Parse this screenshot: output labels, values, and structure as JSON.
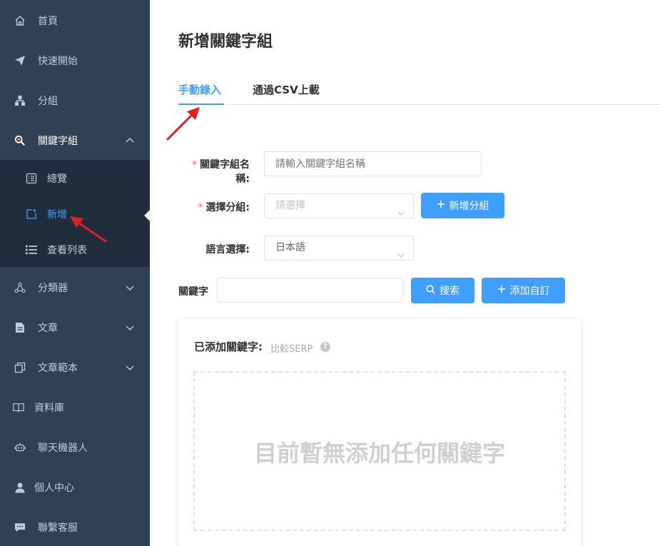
{
  "sidebar": {
    "items": [
      {
        "label": "首頁",
        "icon": "home-icon"
      },
      {
        "label": "快速開始",
        "icon": "paper-plane-icon"
      },
      {
        "label": "分組",
        "icon": "sitemap-icon"
      },
      {
        "label": "關鍵字組",
        "icon": "search-key-icon",
        "expanded": true
      },
      {
        "label": "分類器",
        "icon": "classifier-icon"
      },
      {
        "label": "文章",
        "icon": "document-icon"
      },
      {
        "label": "文章範本",
        "icon": "copy-icon"
      },
      {
        "label": "資料庫",
        "icon": "book-icon"
      },
      {
        "label": "聊天機器人",
        "icon": "robot-icon"
      },
      {
        "label": "個人中心",
        "icon": "user-icon"
      },
      {
        "label": "聯繫客服",
        "icon": "chat-icon"
      }
    ],
    "submenu": [
      {
        "label": "總覽",
        "icon": "list-alt-icon"
      },
      {
        "label": "新增",
        "icon": "new-doc-icon",
        "active": true
      },
      {
        "label": "查看列表",
        "icon": "list-icon"
      }
    ]
  },
  "main": {
    "title": "新增關鍵字組",
    "tabs": [
      {
        "label": "手動錄入",
        "active": true
      },
      {
        "label": "通過CSV上載",
        "active": false
      }
    ],
    "form": {
      "name_label": "關鍵字組名稱:",
      "name_placeholder": "請輸入關鍵字組名稱",
      "group_label": "選擇分組:",
      "group_placeholder": "請選擇",
      "add_group_button": "新增分組",
      "lang_label": "語言選擇:",
      "lang_value": "日本語",
      "keyword_label": "關鍵字",
      "keyword_value": "",
      "search_button": "搜索",
      "custom_button": "添加自訂"
    },
    "card": {
      "title": "已添加關鍵字:",
      "compare": "比較SERP",
      "help": "?",
      "empty": "目前暫無添加任何關鍵字"
    }
  },
  "colors": {
    "sidebar_bg": "#304156",
    "submenu_bg": "#1f2d3d",
    "primary": "#409eff",
    "required": "#f56c6c",
    "annotation_arrow": "#e02020"
  }
}
